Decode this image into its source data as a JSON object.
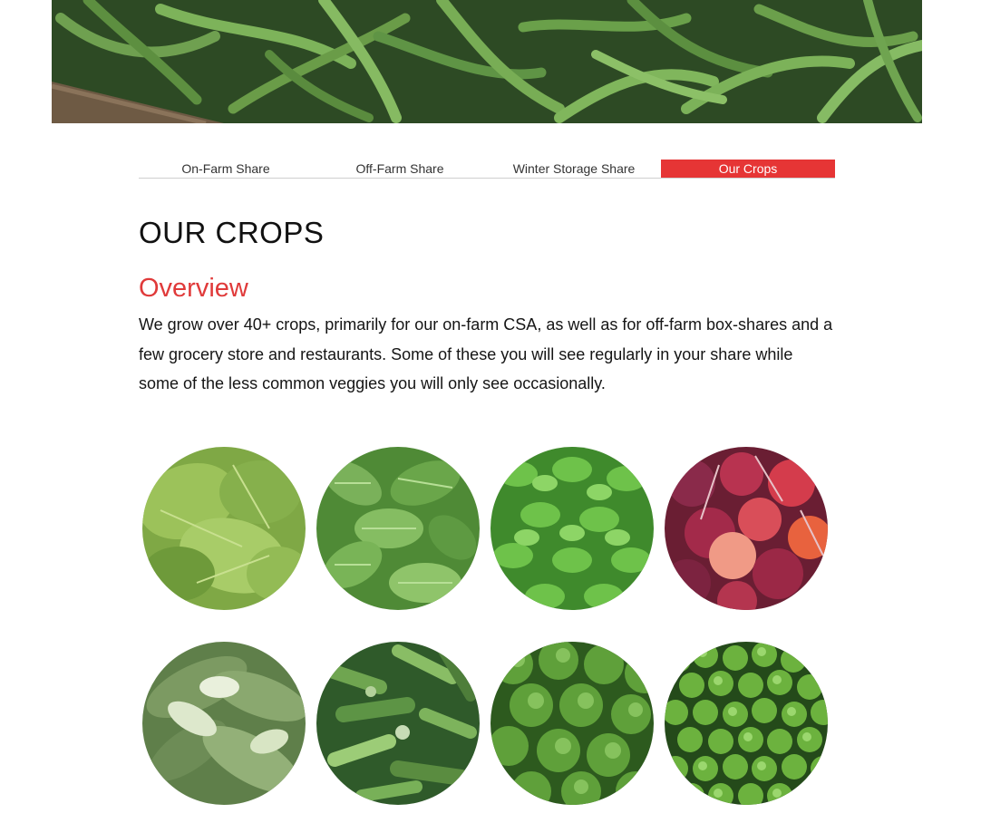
{
  "tabs": [
    {
      "label": "On-Farm Share",
      "active": false
    },
    {
      "label": "Off-Farm Share",
      "active": false
    },
    {
      "label": "Winter Storage Share",
      "active": false
    },
    {
      "label": "Our Crops",
      "active": true
    }
  ],
  "page": {
    "title": "OUR CROPS"
  },
  "overview": {
    "heading": "Overview",
    "text": "We grow over 40+ crops, primarily for our on-farm CSA, as well as for off-farm box-shares and a few grocery store and restaurants. Some of these you will see regularly in your share while some of the less common veggies you will only see occasionally."
  },
  "crops": [
    {
      "image": "amaranth-greens-photo"
    },
    {
      "image": "spinach-photo"
    },
    {
      "image": "basil-photo"
    },
    {
      "image": "beets-photo"
    },
    {
      "image": "bok-choy-photo"
    },
    {
      "image": "salad-mix-photo"
    },
    {
      "image": "broccoli-photo"
    },
    {
      "image": "brussels-sprouts-photo"
    }
  ],
  "colors": {
    "accent": "#e63535",
    "heading_red": "#e03a3a",
    "tab_border": "#cfcfcf"
  }
}
